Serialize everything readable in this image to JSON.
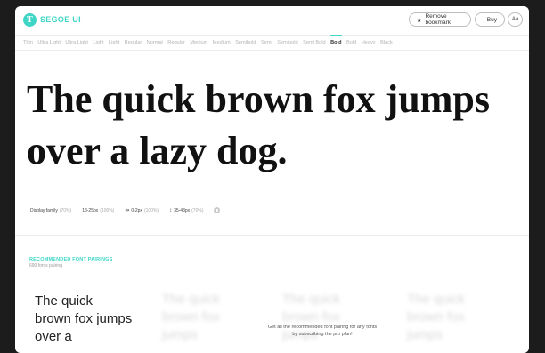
{
  "app": {
    "logo_letter": "T",
    "brand": "SEGOE UI"
  },
  "header": {
    "remove_bookmark": "Remove bookmark",
    "buy": "Buy",
    "aa": "Aa"
  },
  "weights": [
    "Thin",
    "Ultra Light",
    "Ultra Light",
    "Light",
    "Light",
    "Regular",
    "Normal",
    "Regular",
    "Medium",
    "Medium",
    "Semibold",
    "Semi",
    "Semibold",
    "Semi Bold",
    "Bold",
    "Bold",
    "Heavy",
    "Black"
  ],
  "active_weight": "Bold",
  "preview": {
    "line1": "The quick brown fox jumps",
    "line2": "over a lazy dog."
  },
  "controls": {
    "family_label": "Display family",
    "family_pct": "(70%)",
    "size_label": "18-25px",
    "size_pct": "(100%)",
    "spacing_label": "0-2px",
    "spacing_pct": "(100%)",
    "lineheight_label": "35-43px",
    "lineheight_pct": "(70%)"
  },
  "pairings": {
    "title": "RECOMMENDED FONT PAIRINGS",
    "subtitle": "690 fonts pairing",
    "sample": "The quick brown fox jumps over a",
    "blurred_sample": "The quick brown fox jumps",
    "pro_message_1": "Get all the recommended font pairing for any fonts",
    "pro_message_2": "by subscribing the pro plan!"
  }
}
